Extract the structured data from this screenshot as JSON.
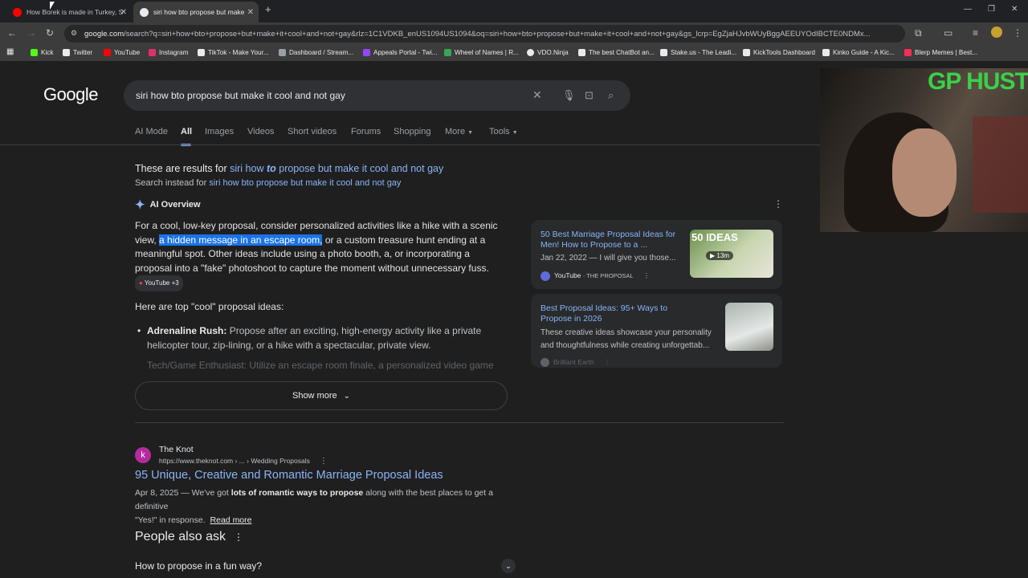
{
  "browser": {
    "tabs": [
      {
        "title": "How Borek is made in Turkey, S",
        "active": false
      },
      {
        "title": "siri how bto propose but make",
        "active": true
      }
    ],
    "new_tab": "+",
    "url_domain": "google.com",
    "url_path": "/search?q=siri+how+bto+propose+but+make+it+cool+and+not+gay&rlz=1C1VDKB_enUS1094US1094&oq=siri+how+bto+propose+but+make+it+cool+and+not+gay&gs_lcrp=EgZjaHJvbWUyBggAEEUYOdIBCTE0NDMx...",
    "bookmarks": [
      {
        "label": "Kick",
        "color": "#53fc18"
      },
      {
        "label": "Twitter",
        "color": "#e8eaed"
      },
      {
        "label": "YouTube",
        "color": "#ff0000"
      },
      {
        "label": "Instagram",
        "color": "#e1306c"
      },
      {
        "label": "TikTok - Make Your...",
        "color": "#e8eaed"
      },
      {
        "label": "Dashboard / Stream...",
        "color": "#9aa0a6"
      },
      {
        "label": "Appeals Portal - Twi...",
        "color": "#9146ff"
      },
      {
        "label": "Wheel of Names | R...",
        "color": "#34a853"
      },
      {
        "label": "VDO.Ninja",
        "color": "#e8eaed"
      },
      {
        "label": "The best ChatBot an...",
        "color": "#e8eaed"
      },
      {
        "label": "Stake.us - The Leadi...",
        "color": "#e8eaed"
      },
      {
        "label": "KickTools Dashboard",
        "color": "#e8eaed"
      },
      {
        "label": "Kinko Guide - A Kic...",
        "color": "#e8eaed"
      },
      {
        "label": "Blerp Memes | Best...",
        "color": "#ff2d55"
      }
    ]
  },
  "google": {
    "logo": "Google",
    "query": "siri how bto propose but make it cool and not gay",
    "tabs": [
      "AI Mode",
      "All",
      "Images",
      "Videos",
      "Short videos",
      "Forums",
      "Shopping",
      "More",
      "Tools"
    ],
    "selected_tab": "All",
    "correction_prefix": "These are results for ",
    "correction_a": "siri how ",
    "correction_b": "to",
    "correction_c": " propose but make it cool and not gay",
    "instead_prefix": "Search instead for ",
    "instead_query": "siri how bto propose but make it cool and not gay",
    "ai_overview_label": "AI Overview",
    "ai_p1_a": "For a cool, low-key proposal, consider personalized activities like a hike with a scenic view, ",
    "ai_p1_hl": "a hidden message in an escape room,",
    "ai_p1_b": " or a custom treasure hunt ending at a meaningful spot. Other ideas include using a photo booth, a, or incorporating a proposal into a \"fake\" photoshoot to capture the moment without unnecessary fuss.",
    "ai_chip": "YouTube +3",
    "cool_heading": "Here are top \"cool\" proposal ideas:",
    "bullet1_bold": "Adrenaline Rush:",
    "bullet1_text": " Propose after an exciting, high-energy activity like a private helicopter tour, zip-lining, or a hike with a spectacular, private view.",
    "bullet2_faded": "Tech/Game Enthusiast: Utilize an escape room finale, a personalized video game",
    "show_more": "Show more",
    "cards": [
      {
        "title": "50 Best Marriage Proposal Ideas for Men! How to Propose to a ...",
        "snippet": "Jan 22, 2022 — I will give you those...",
        "source": "YouTube",
        "channel": "· THE PROPOSAL",
        "thumb_text": "50 IDEAS",
        "duration": "13m"
      },
      {
        "title": "Best Proposal Ideas: 95+ Ways to Propose in 2026",
        "snippet1": "These creative ideas showcase your personality",
        "snippet2": "and thoughtfulness while creating unforgettab...",
        "source": "Brilliant Earth"
      }
    ],
    "result": {
      "site": "The Knot",
      "url": "https://www.theknot.com › ... › Wedding Proposals",
      "title": "95 Unique, Creative and Romantic Marriage Proposal Ideas",
      "date": "Apr 8, 2025",
      "snip_a": " — We've got ",
      "snip_bold": "lots of romantic ways to propose",
      "snip_b": " along with the best places to get a definitive",
      "snip_c": "\"Yes!\" in response.",
      "read_more": "Read more"
    },
    "paa_heading": "People also ask",
    "paa_q1": "How to propose in a fun way?"
  },
  "overlay": {
    "brand": "GP HUSTLA"
  }
}
